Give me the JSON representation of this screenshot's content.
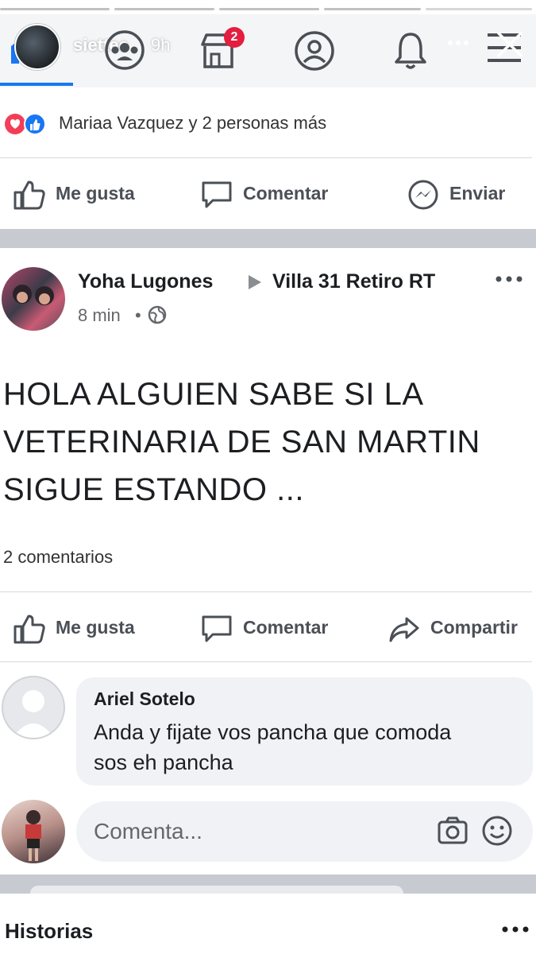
{
  "story": {
    "user": "siettee",
    "time": "9h"
  },
  "nav": {
    "marketplace_badge": "2"
  },
  "reactions_bar": {
    "text": "Mariaa Vazquez y 2 personas más"
  },
  "top_actions": {
    "like": "Me gusta",
    "comment": "Comentar",
    "send": "Enviar"
  },
  "post": {
    "author": "Yoha Lugones",
    "group": "Villa 31 Retiro RT",
    "time": "8 min",
    "separator": "•",
    "body_lines": [
      "HOLA ALGUIEN  SABE SI LA",
      "VETERINARIA DE SAN MARTIN",
      "SIGUE ESTANDO ..."
    ],
    "comments_count": "2 comentarios",
    "actions": {
      "like": "Me gusta",
      "comment": "Comentar",
      "share": "Compartir"
    }
  },
  "comment": {
    "author": "Ariel Sotelo",
    "lines": [
      "Anda y fijate vos pancha que comoda",
      "sos  eh pancha"
    ]
  },
  "composer": {
    "placeholder": "Comenta..."
  },
  "stories": {
    "title": "Historias"
  },
  "colors": {
    "accent": "#1877f2",
    "badge": "#e41e3f",
    "band": "#c7cbd1"
  }
}
